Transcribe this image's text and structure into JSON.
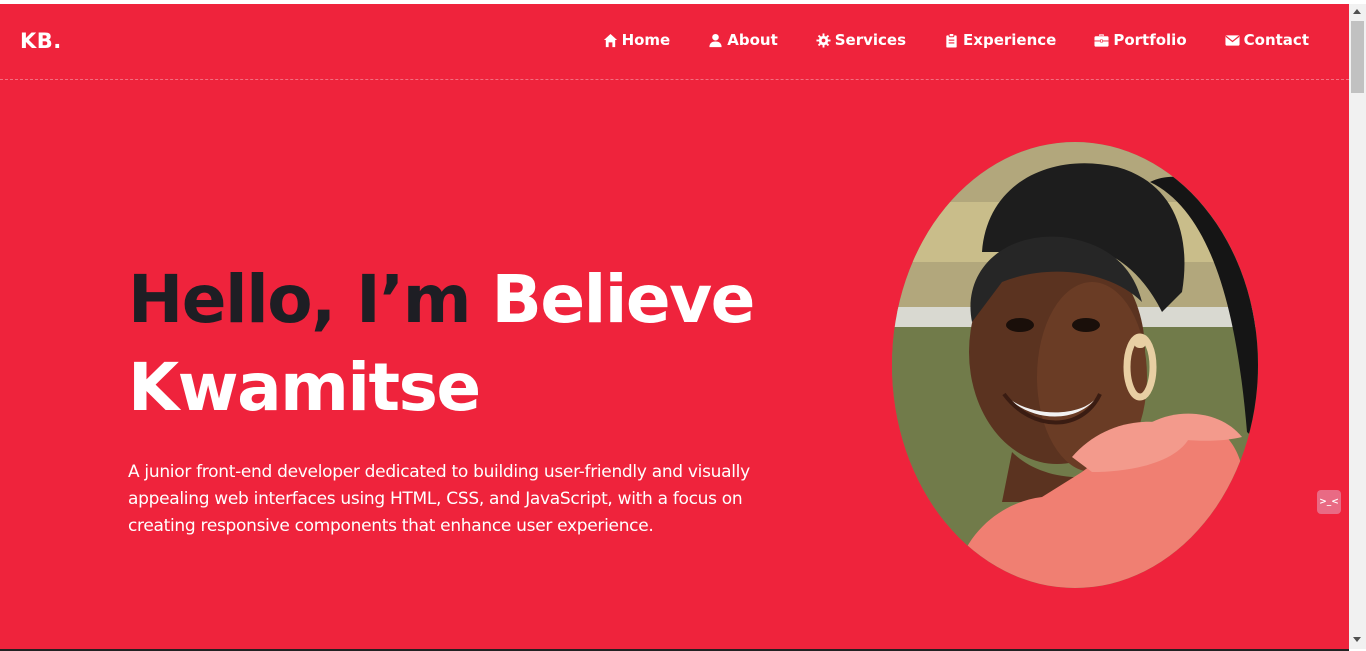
{
  "brand": {
    "logo": "KB.",
    "accent_color": "#ef233c",
    "dark_text_color": "#1e1e24"
  },
  "nav": {
    "items": [
      {
        "label": "Home",
        "icon": "home-icon"
      },
      {
        "label": "About",
        "icon": "user-icon"
      },
      {
        "label": "Services",
        "icon": "cog-icon"
      },
      {
        "label": "Experience",
        "icon": "clipboard-icon"
      },
      {
        "label": "Portfolio",
        "icon": "briefcase-icon"
      },
      {
        "label": "Contact",
        "icon": "envelope-icon"
      }
    ]
  },
  "hero": {
    "greeting": "Hello, I’m",
    "first_name": "Believe",
    "last_name": "Kwamitse",
    "description": "A junior front-end developer dedicated to building user-friendly and visually appealing web interfaces using HTML, CSS, and JavaScript, with a focus on creating responsive components that enhance user experience."
  },
  "widget": {
    "icon": "code-widget-icon",
    "label": ">_<"
  }
}
